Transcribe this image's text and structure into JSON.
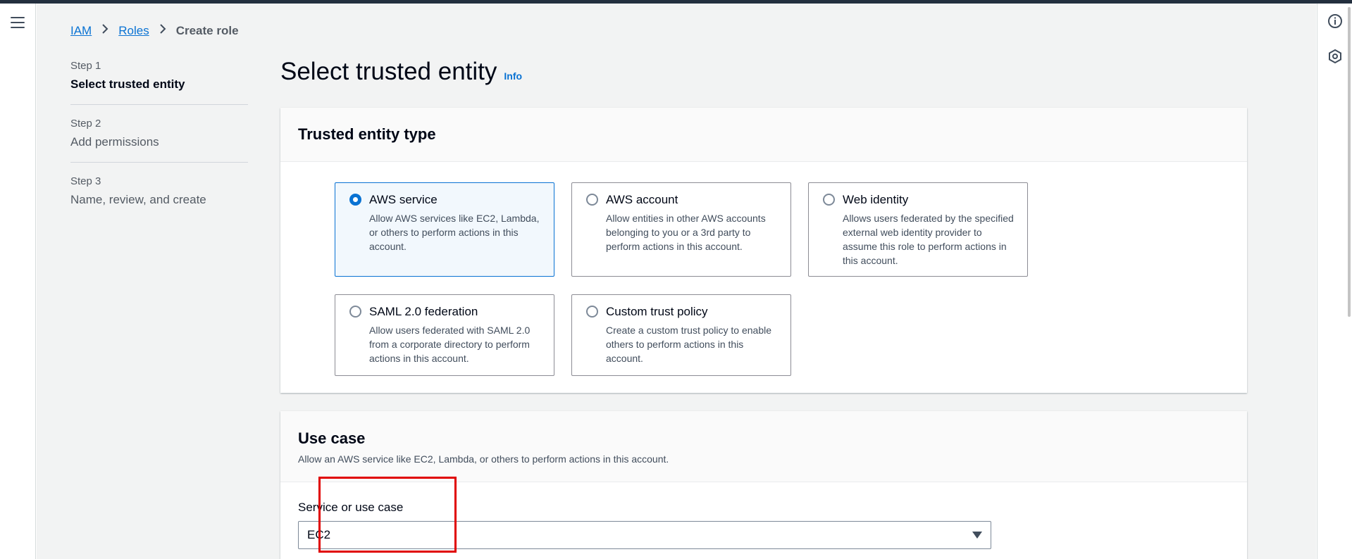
{
  "breadcrumb": {
    "items": [
      "IAM",
      "Roles"
    ],
    "current": "Create role",
    "separator": ">"
  },
  "steps": [
    {
      "num": "Step 1",
      "title": "Select trusted entity"
    },
    {
      "num": "Step 2",
      "title": "Add permissions"
    },
    {
      "num": "Step 3",
      "title": "Name, review, and create"
    }
  ],
  "page": {
    "title": "Select trusted entity",
    "info": "Info"
  },
  "trusted_entity": {
    "heading": "Trusted entity type",
    "options": [
      {
        "title": "AWS service",
        "desc": "Allow AWS services like EC2, Lambda, or others to perform actions in this account.",
        "selected": true
      },
      {
        "title": "AWS account",
        "desc": "Allow entities in other AWS accounts belonging to you or a 3rd party to perform actions in this account.",
        "selected": false
      },
      {
        "title": "Web identity",
        "desc": "Allows users federated by the specified external web identity provider to assume this role to perform actions in this account.",
        "selected": false
      },
      {
        "title": "SAML 2.0 federation",
        "desc": "Allow users federated with SAML 2.0 from a corporate directory to perform actions in this account.",
        "selected": false
      },
      {
        "title": "Custom trust policy",
        "desc": "Create a custom trust policy to enable others to perform actions in this account.",
        "selected": false
      }
    ]
  },
  "use_case": {
    "heading": "Use case",
    "desc": "Allow an AWS service like EC2, Lambda, or others to perform actions in this account.",
    "field_label": "Service or use case",
    "selected_value": "EC2"
  },
  "colors": {
    "accent": "#0972d3",
    "highlight": "#e00000",
    "topbar": "#232f3e"
  }
}
